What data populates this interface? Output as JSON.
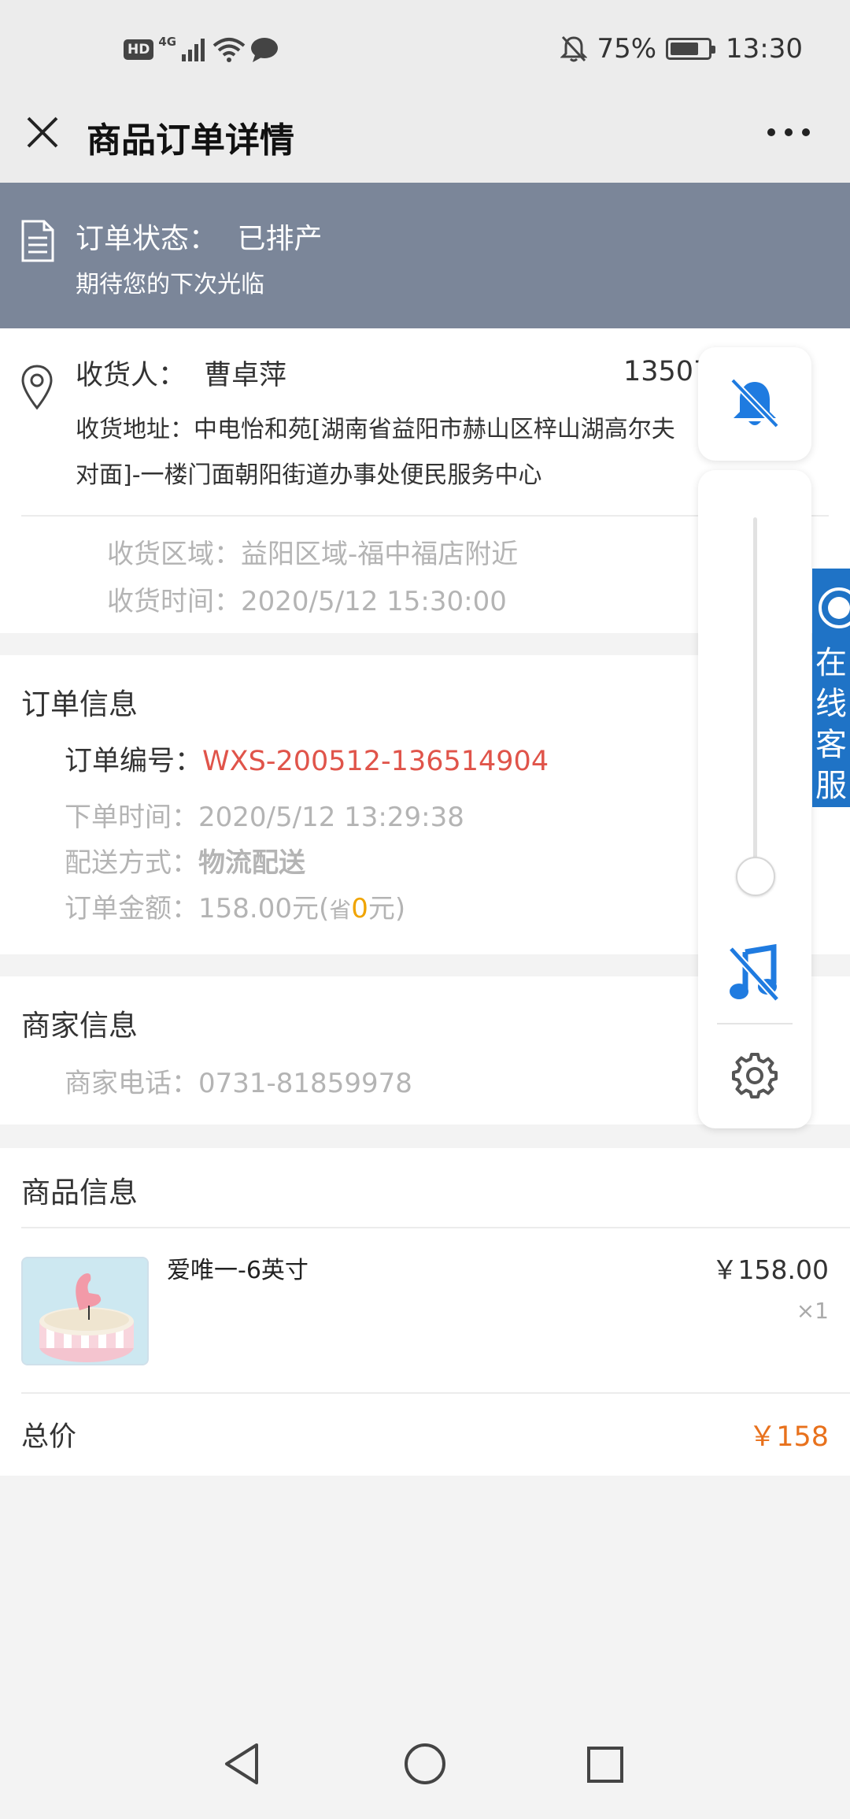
{
  "status_bar": {
    "network": "4G",
    "hd": "HD",
    "battery": "75%",
    "battery_level": 0.75,
    "time": "13:30"
  },
  "header": {
    "title": "商品订单详情"
  },
  "order_status": {
    "label": "订单状态：",
    "value": "已排产",
    "subtitle": "期待您的下次光临"
  },
  "address": {
    "receiver_label": "收货人：",
    "receiver_name": "曹卓萍",
    "receiver_phone": "13507",
    "address_label": "收货地址：",
    "address_line1": "中电怡和苑[湖南省益阳市赫山区梓山湖高尔夫",
    "address_line2": "对面]-一楼门面朝阳街道办事处便民服务中心",
    "region_label": "收货区域：",
    "region_value": "益阳区域-福中福店附近",
    "time_label": "收货时间：",
    "time_value": "2020/5/12 15:30:00"
  },
  "order_info": {
    "section_title": "订单信息",
    "number_label": "订单编号：",
    "number_value": "WXS-200512-136514904",
    "order_time_label": "下单时间：",
    "order_time_value": "2020/5/12 13:29:38",
    "delivery_label": "配送方式：",
    "delivery_value": "物流配送",
    "amount_label": "订单金额：",
    "amount_value": "158.00元(",
    "save_prefix": "省",
    "save_value": "0",
    "save_suffix": "元)"
  },
  "merchant": {
    "section_title": "商家信息",
    "phone_label": "商家电话：",
    "phone_value": "0731-81859978"
  },
  "goods": {
    "section_title": "商品信息",
    "items": [
      {
        "name": "爱唯一-6英寸",
        "price": "￥158.00",
        "qty": "×1"
      }
    ],
    "total_label": "总价",
    "total_value": "￥158"
  },
  "float_panel": {
    "volume_level": 0.05
  },
  "service_tab": {
    "label": "在线客服"
  },
  "colors": {
    "status_banner": "#7b8699",
    "accent_blue": "#1f73c6",
    "order_number_red": "#e0544a",
    "price_orange": "#e8711c",
    "save_orange": "#f0a400"
  }
}
